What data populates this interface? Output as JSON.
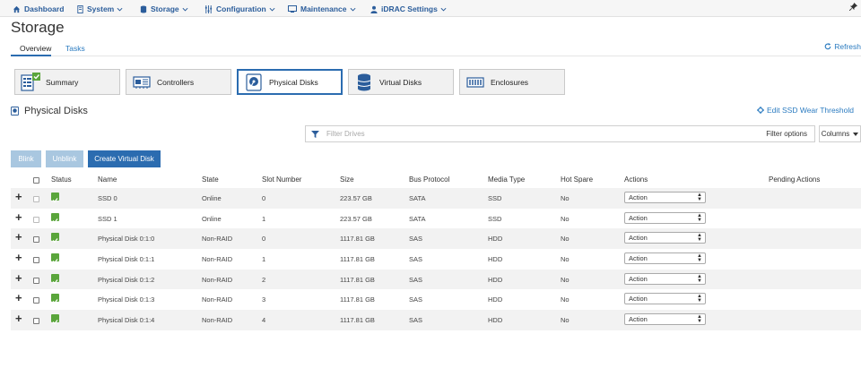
{
  "nav": {
    "dashboard": "Dashboard",
    "system": "System",
    "storage": "Storage",
    "configuration": "Configuration",
    "maintenance": "Maintenance",
    "idrac_settings": "iDRAC Settings"
  },
  "page": {
    "title": "Storage",
    "tabs": [
      "Overview",
      "Tasks"
    ],
    "refresh": "Refresh"
  },
  "tiles": [
    "Summary",
    "Controllers",
    "Physical Disks",
    "Virtual Disks",
    "Enclosures"
  ],
  "section": {
    "title": "Physical Disks",
    "wear_link": "Edit SSD Wear Threshold"
  },
  "filter": {
    "placeholder": "Filter Drives",
    "options_label": "Filter options",
    "columns_label": "Columns"
  },
  "buttons": {
    "blink": "Blink",
    "unblink": "Unblink",
    "create_vd": "Create Virtual Disk"
  },
  "table": {
    "headers": {
      "status": "Status",
      "name": "Name",
      "state": "State",
      "slot": "Slot Number",
      "size": "Size",
      "bus": "Bus Protocol",
      "media": "Media Type",
      "hot_spare": "Hot Spare",
      "actions": "Actions",
      "pending": "Pending Actions"
    },
    "rows": [
      {
        "name": "SSD 0",
        "state": "Online",
        "slot": "0",
        "size": "223.57 GB",
        "bus": "SATA",
        "media": "SSD",
        "hot_spare": "No",
        "action": "Action"
      },
      {
        "name": "SSD 1",
        "state": "Online",
        "slot": "1",
        "size": "223.57 GB",
        "bus": "SATA",
        "media": "SSD",
        "hot_spare": "No",
        "action": "Action"
      },
      {
        "name": "Physical Disk 0:1:0",
        "state": "Non-RAID",
        "slot": "0",
        "size": "1117.81 GB",
        "bus": "SAS",
        "media": "HDD",
        "hot_spare": "No",
        "action": "Action"
      },
      {
        "name": "Physical Disk 0:1:1",
        "state": "Non-RAID",
        "slot": "1",
        "size": "1117.81 GB",
        "bus": "SAS",
        "media": "HDD",
        "hot_spare": "No",
        "action": "Action"
      },
      {
        "name": "Physical Disk 0:1:2",
        "state": "Non-RAID",
        "slot": "2",
        "size": "1117.81 GB",
        "bus": "SAS",
        "media": "HDD",
        "hot_spare": "No",
        "action": "Action"
      },
      {
        "name": "Physical Disk 0:1:3",
        "state": "Non-RAID",
        "slot": "3",
        "size": "1117.81 GB",
        "bus": "SAS",
        "media": "HDD",
        "hot_spare": "No",
        "action": "Action"
      },
      {
        "name": "Physical Disk 0:1:4",
        "state": "Non-RAID",
        "slot": "4",
        "size": "1117.81 GB",
        "bus": "SAS",
        "media": "HDD",
        "hot_spare": "No",
        "action": "Action"
      }
    ]
  },
  "colors": {
    "link": "#2b7bc0",
    "primary": "#2b6cb0",
    "status_ok": "#5aa53b"
  }
}
